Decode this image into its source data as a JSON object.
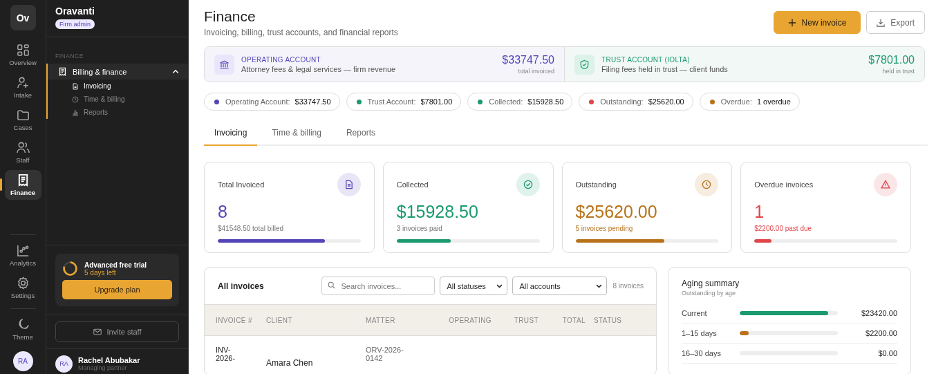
{
  "rail": {
    "logo": "Ov",
    "items": [
      {
        "label": "Overview",
        "selected": false
      },
      {
        "label": "Intake",
        "selected": false
      },
      {
        "label": "Cases",
        "selected": false
      },
      {
        "label": "Staff",
        "selected": false
      },
      {
        "label": "Finance",
        "selected": true
      }
    ],
    "bottom_items": [
      {
        "label": "Analytics"
      },
      {
        "label": "Settings"
      }
    ],
    "theme": {
      "label": "Theme"
    },
    "avatar": "RA"
  },
  "sidebar": {
    "org": "Oravanti",
    "role": "Firm admin",
    "section": "FINANCE",
    "group": {
      "label": "Billing & finance",
      "expanded": true,
      "children": [
        {
          "label": "Invoicing",
          "selected": true
        },
        {
          "label": "Time & billing",
          "selected": false
        },
        {
          "label": "Reports",
          "selected": false
        }
      ]
    },
    "trial": {
      "title": "Advanced free trial",
      "days": "5 days left",
      "button": "Upgrade plan"
    },
    "invite": "Invite staff",
    "user": {
      "initials": "RA",
      "name": "Rachel Abubakar",
      "role": "Managing partner"
    }
  },
  "header": {
    "title": "Finance",
    "subtitle": "Invoicing, billing, trust accounts, and financial reports",
    "actions": [
      {
        "label": "New invoice",
        "kind": "primary"
      },
      {
        "label": "Export",
        "kind": "secondary"
      }
    ]
  },
  "accounts": [
    {
      "kind": "operating",
      "title": "OPERATING ACCOUNT",
      "description": "Attorney fees & legal services — firm revenue",
      "amount": "$33747.50",
      "amount_label": "total invoiced"
    },
    {
      "kind": "trust",
      "title": "TRUST ACCOUNT (IOLTA)",
      "description": "Filing fees held in trust — client funds",
      "amount": "$7801.00",
      "amount_label": "held in trust"
    }
  ],
  "pills": [
    {
      "label": "Operating Account:",
      "value": "$33747.50",
      "color": "#5145b8"
    },
    {
      "label": "Trust Account:",
      "value": "$7801.00",
      "color": "#1a9a6e"
    },
    {
      "label": "Collected:",
      "value": "$15928.50",
      "color": "#1a9a6e"
    },
    {
      "label": "Outstanding:",
      "value": "$25620.00",
      "color": "#e0454a"
    },
    {
      "label": "Overdue:",
      "value": "1 overdue",
      "color": "#b8731a"
    }
  ],
  "tabs": [
    {
      "label": "Invoicing",
      "selected": true
    },
    {
      "label": "Time & billing",
      "selected": false
    },
    {
      "label": "Reports",
      "selected": false
    }
  ],
  "stats": [
    {
      "title": "Total Invoiced",
      "value": "8",
      "sub": "$41548.50 total billed",
      "level": 0.75,
      "color": "#5145b8"
    },
    {
      "title": "Collected",
      "value": "$15928.50",
      "sub": "3 invoices paid",
      "level": 0.38,
      "color": "#1a9a6e"
    },
    {
      "title": "Outstanding",
      "value": "$25620.00",
      "sub": "5 invoices pending",
      "level": 0.62,
      "color": "#b8731a"
    },
    {
      "title": "Overdue invoices",
      "value": "1",
      "sub": "$2200.00 past due",
      "level": 0.12,
      "color": "#e0454a"
    }
  ],
  "invoices": {
    "title": "All invoices",
    "search": {
      "placeholder": "Search invoices..."
    },
    "filters": [
      "All statuses",
      "All accounts"
    ],
    "count": "8 invoices",
    "columns": [
      "INVOICE #",
      "CLIENT",
      "MATTER",
      "OPERATING",
      "TRUST",
      "TOTAL",
      "STATUS"
    ],
    "rows": [
      {
        "invoice": "INV-2026-",
        "client": "Amara Chen",
        "matter": "ORV-2026-0142"
      }
    ]
  },
  "aging": {
    "title": "Aging summary",
    "subtitle": "Outstanding by age",
    "rows": [
      {
        "label": "Current",
        "level": 0.9,
        "amount": "$23420.00",
        "color": "#1a9a6e"
      },
      {
        "label": "1–15 days",
        "level": 0.09,
        "amount": "$2200.00",
        "color": "#b8731a"
      },
      {
        "label": "16–30 days",
        "amount": "$0.00"
      }
    ]
  }
}
